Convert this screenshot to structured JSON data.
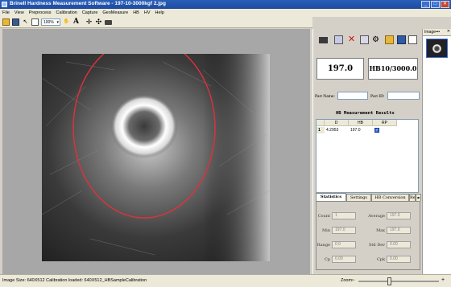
{
  "window": {
    "title": "Brinell Hardness Measurement Software - 197-10-3000kgf 2.jpg"
  },
  "menu": [
    "File",
    "View",
    "Preprocess",
    "Calibration",
    "Capture",
    "GeoMeasure",
    "HB",
    "HV",
    "Help"
  ],
  "toolbar": {
    "zoom_value": "100%",
    "font_icon": "A"
  },
  "panel": {
    "hardness_value": "197.0",
    "scale_value": "HB10/3000.0",
    "part_name_label": "Part Name:",
    "part_name_value": "",
    "part_id_label": "Part ID:",
    "part_id_value": "",
    "results_title": "HB Measurement Results",
    "table_headers": [
      "D",
      "HB",
      "RP"
    ],
    "table_row": {
      "index": "1",
      "d": "4.2953",
      "hb": "197.0",
      "rp_checked": true
    }
  },
  "tabs": [
    "Statistics",
    "Settings",
    "HB Conversion",
    "Re"
  ],
  "stats": {
    "count_label": "Count",
    "count_value": "1",
    "average_label": "Average",
    "average_value": "197.0",
    "min_label": "Min",
    "min_value": "197.0",
    "max_label": "Max",
    "max_value": "197.0",
    "range_label": "Range",
    "range_value": "0.0",
    "stddev_label": "Std Dev",
    "stddev_value": "0.00",
    "cp_label": "Cp",
    "cp_value": "0.00",
    "cpk_label": "Cpk",
    "cpk_value": "0.00"
  },
  "image_panel": {
    "title": "Image•••"
  },
  "status": {
    "text": "Image Size: 640X512  Calibration loaded: 640X512_HBSampleCalibration",
    "zoom_label": "Zoom:",
    "zoom_fraction": 0.38
  },
  "colors": {
    "measurement_circle": "#e0313d",
    "titlebar": "#2a5fb8"
  }
}
